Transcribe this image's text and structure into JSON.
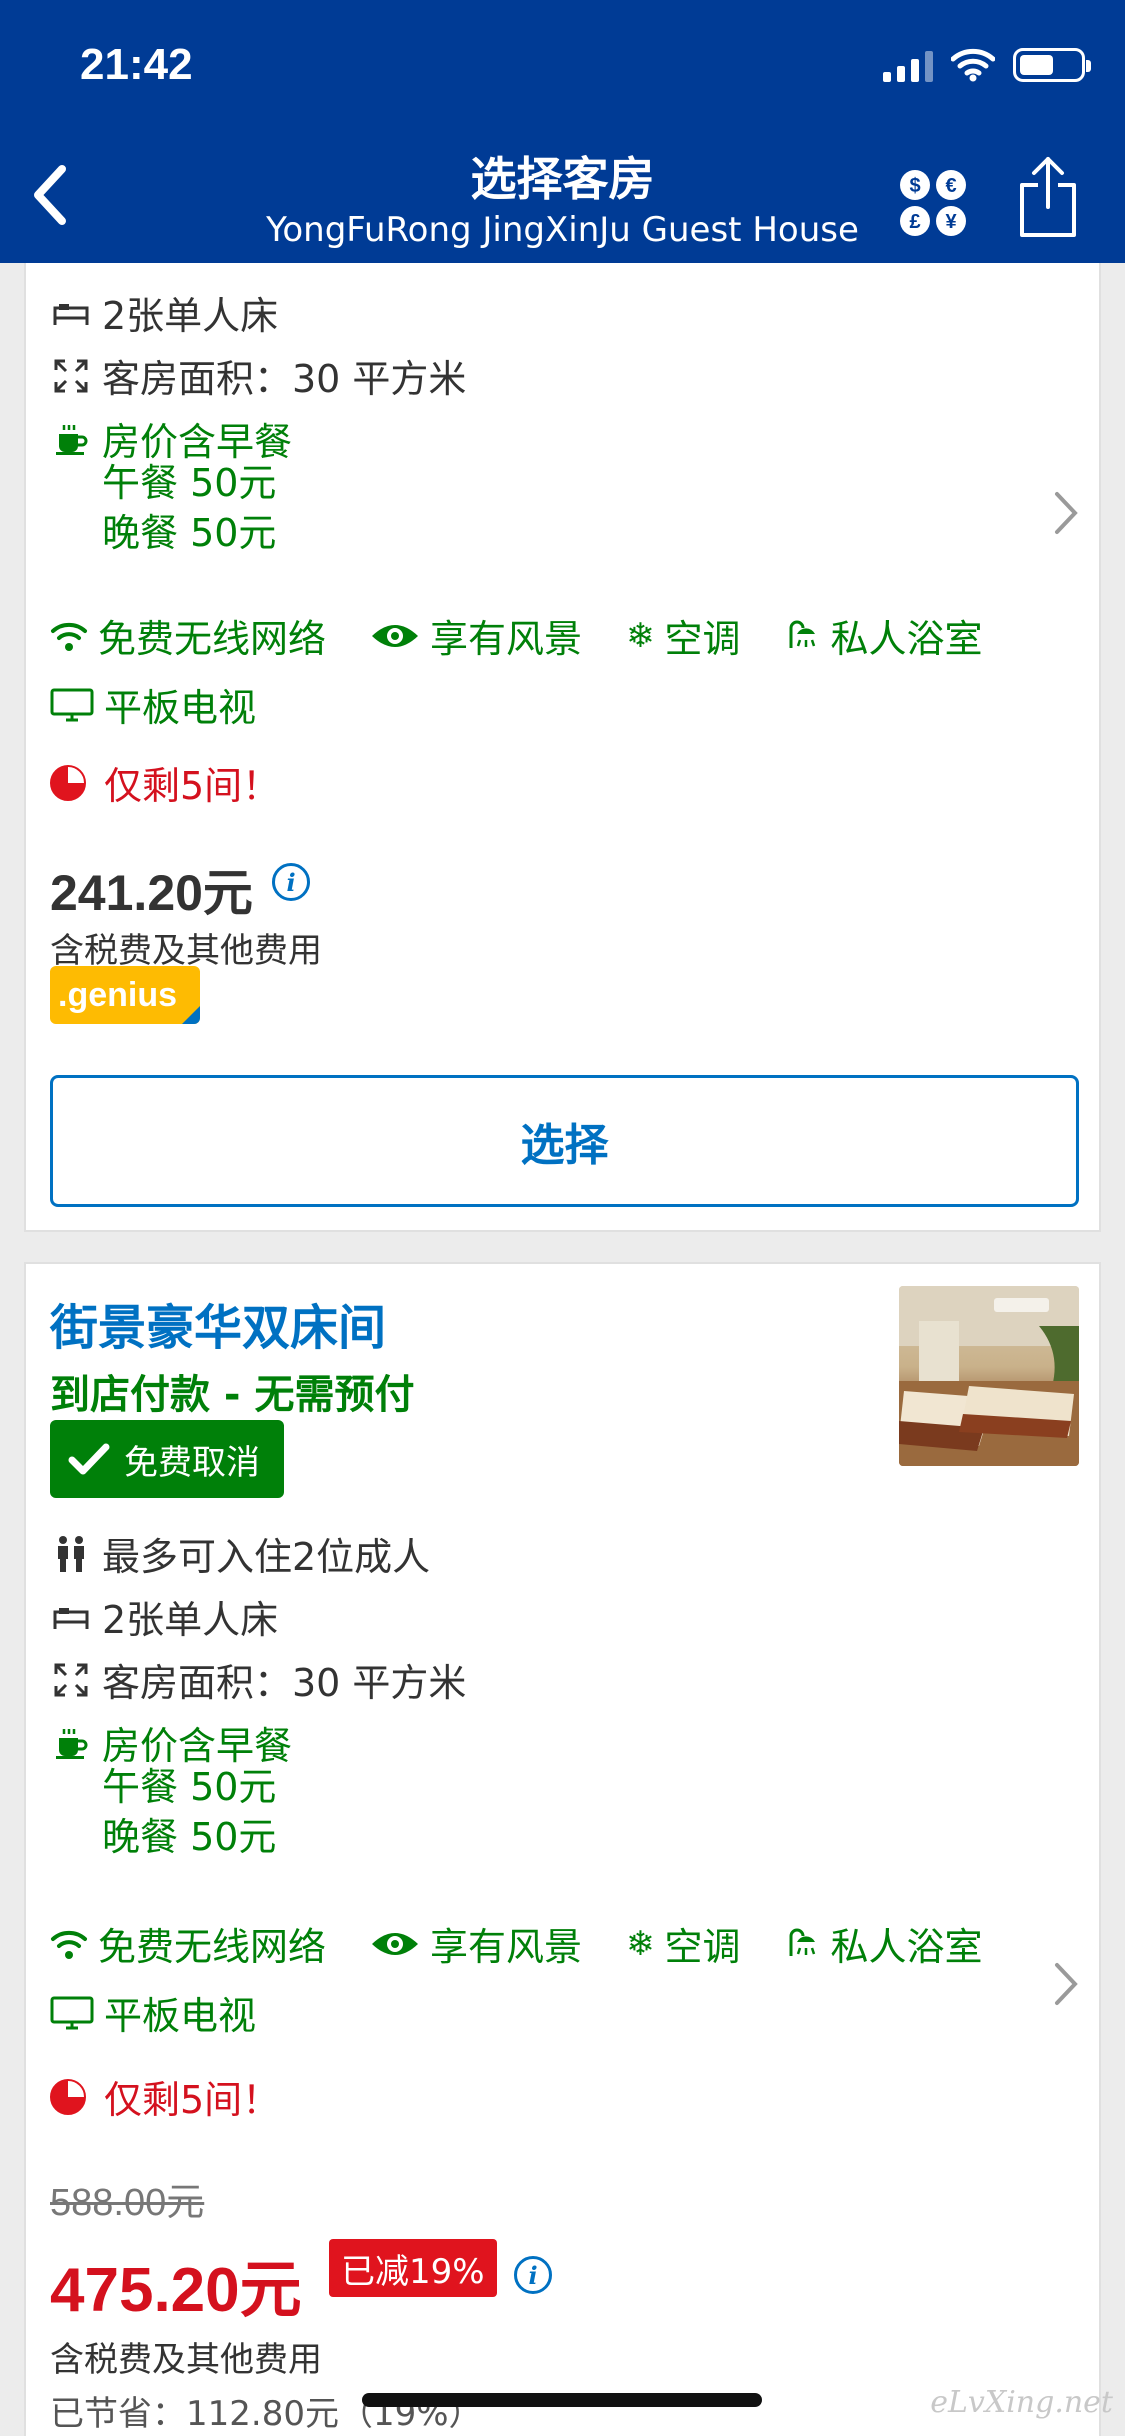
{
  "status_bar": {
    "time": "21:42"
  },
  "nav": {
    "title": "选择客房",
    "subtitle": "YongFuRong JingXinJu Guest House"
  },
  "rooms": [
    {
      "bed": "2张单人床",
      "area": "客房面积：30 平方米",
      "breakfast": "房价含早餐",
      "lunch": "午餐 50元",
      "dinner": "晚餐 50元",
      "facilities": [
        "免费无线网络",
        "享有风景",
        "空调",
        "私人浴室",
        "平板电视"
      ],
      "scarcity": "仅剩5间！",
      "price": "241.20元",
      "tax_note": "含税费及其他费用",
      "badge": ".genius",
      "select_label": "选择"
    },
    {
      "name": "街景豪华双床间",
      "payment": "到店付款 - 无需预付",
      "free_cancel": "免费取消",
      "occupancy": "最多可入住2位成人",
      "bed": "2张单人床",
      "area": "客房面积：30 平方米",
      "breakfast": "房价含早餐",
      "lunch": "午餐 50元",
      "dinner": "晚餐 50元",
      "facilities": [
        "免费无线网络",
        "享有风景",
        "空调",
        "私人浴室",
        "平板电视"
      ],
      "scarcity": "仅剩5间！",
      "original_price": "588.00元",
      "price": "475.20元",
      "discount": "已减19%",
      "tax_note": "含税费及其他费用",
      "saved": "已节省：112.80元（19%）"
    }
  ],
  "watermark": "eLvXing.net",
  "colors": {
    "header": "#003b95",
    "link_blue": "#0071c2",
    "green": "#008009",
    "red": "#d4111e",
    "genius_yellow": "#febb02"
  }
}
